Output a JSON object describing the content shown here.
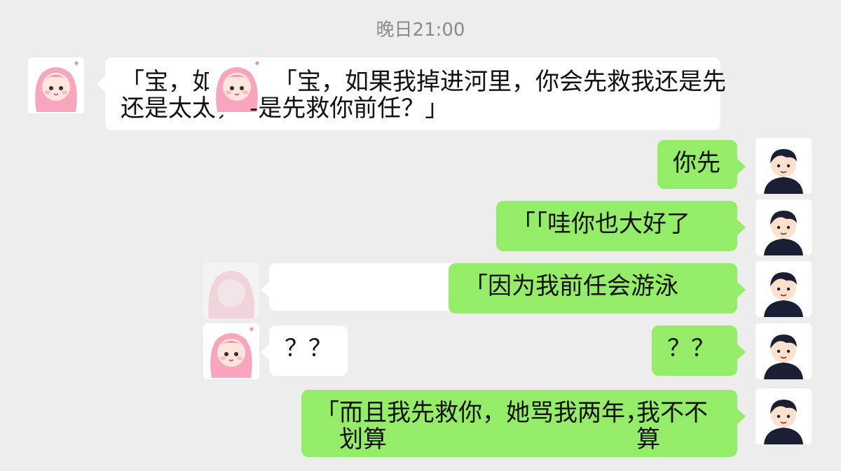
{
  "chat": {
    "timestamp": "晚日21:00",
    "messages": [
      {
        "sender": "girl",
        "text_line1": "「宝，如",
        "text_line2": "还是太太，"
      },
      {
        "sender": "girl",
        "text_line1": "「宝，如果我掉进河里，你会先救我还是先",
        "text_line2": "-是先救你前任？」"
      },
      {
        "sender": "boy",
        "text": "你先"
      },
      {
        "sender": "boy",
        "text": "「「哇你也大好了"
      },
      {
        "sender": "girl",
        "text": ""
      },
      {
        "sender": "boy",
        "text": "「因为我前任会游泳"
      },
      {
        "sender": "girl",
        "text": "？？"
      },
      {
        "sender": "boy",
        "text": "？？"
      },
      {
        "sender": "boy",
        "text_line1": "「而且我先救你，她骂我两年，",
        "text_line2": "划算",
        "text_right_line1": "我不不",
        "text_right_line2": "算"
      }
    ]
  },
  "colors": {
    "background": "#ededed",
    "sent_bubble": "#95ec69",
    "received_bubble": "#ffffff",
    "girl_avatar_hair": "#f7a6bd",
    "boy_avatar_hair": "#1a1f33"
  },
  "icons": {
    "girl_avatar": "pink-hair-girl-avatar-icon",
    "boy_avatar": "dark-hair-boy-avatar-icon"
  }
}
